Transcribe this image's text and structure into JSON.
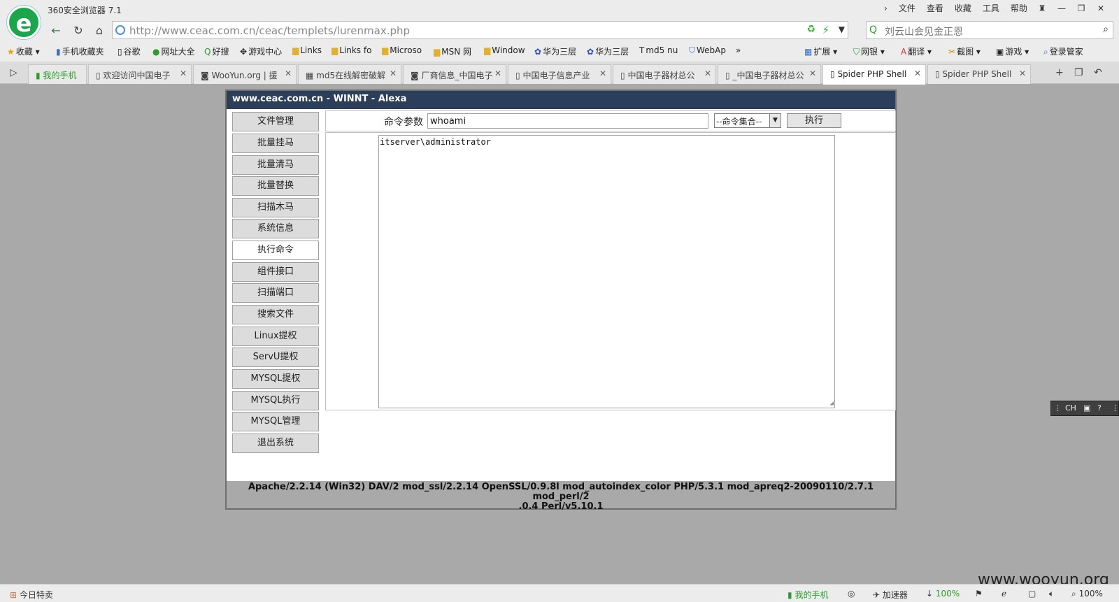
{
  "browser": {
    "app_title": "360安全浏览器 7.1",
    "menu": [
      "文件",
      "查看",
      "收藏",
      "工具",
      "帮助"
    ],
    "url": "http://www.ceac.com.cn/ceac/templets/lurenmax.php",
    "url_host": "www.ceac.com.cn",
    "search_text": "刘云山会见金正恩",
    "bookmarks": [
      "收藏",
      "手机收藏夹",
      "谷歌",
      "网址大全",
      "好搜",
      "游戏中心",
      "Links",
      "Links fo",
      "Microso",
      "MSN 网",
      "Window",
      "华为三层",
      "华为三层",
      "md5 nu",
      "WebAp"
    ],
    "toolbar_right": [
      "扩展",
      "网银",
      "翻译",
      "截图",
      "游戏",
      "登录管家"
    ],
    "tabs": [
      {
        "label": "我的手机",
        "close": false
      },
      {
        "label": "欢迎访问中国电子",
        "close": true
      },
      {
        "label": "WooYun.org | 援",
        "close": true
      },
      {
        "label": "md5在线解密破解",
        "close": true
      },
      {
        "label": "厂商信息_中国电子",
        "close": true
      },
      {
        "label": "中国电子信息产业",
        "close": true
      },
      {
        "label": "中国电子器材总公",
        "close": true
      },
      {
        "label": "_中国电子器材总公",
        "close": true
      },
      {
        "label": "Spider PHP Shell",
        "close": true
      },
      {
        "label": "Spider PHP Shell",
        "close": true
      }
    ]
  },
  "shell": {
    "header": "www.ceac.com.cn - WINNT - Alexa",
    "sidebar": [
      "文件管理",
      "批量挂马",
      "批量清马",
      "批量替换",
      "扫描木马",
      "系统信息",
      "执行命令",
      "组件接口",
      "扫描端口",
      "搜索文件",
      "Linux提权",
      "ServU提权",
      "MYSQL提权",
      "MYSQL执行",
      "MYSQL管理",
      "退出系统"
    ],
    "active_item": "执行命令",
    "cmd_label": "命令参数",
    "cmd_value": "whoami",
    "cmd_select": "--命令集合--",
    "exec_label": "执行",
    "output": "itserver\\administrator",
    "footer_line1": "Apache/2.2.14 (Win32) DAV/2 mod_ssl/2.2.14 OpenSSL/0.9.8l mod_autoindex_color PHP/5.3.1 mod_apreq2-20090110/2.7.1 mod_perl/2",
    "footer_line2": ".0.4 Perl/v5.10.1"
  },
  "ime": "CH",
  "status": {
    "left": "今日特卖",
    "phone": "我的手机",
    "accelerator": "加速器",
    "download": "100%",
    "zoom": "100%"
  },
  "watermark": "www.wooyun.org"
}
